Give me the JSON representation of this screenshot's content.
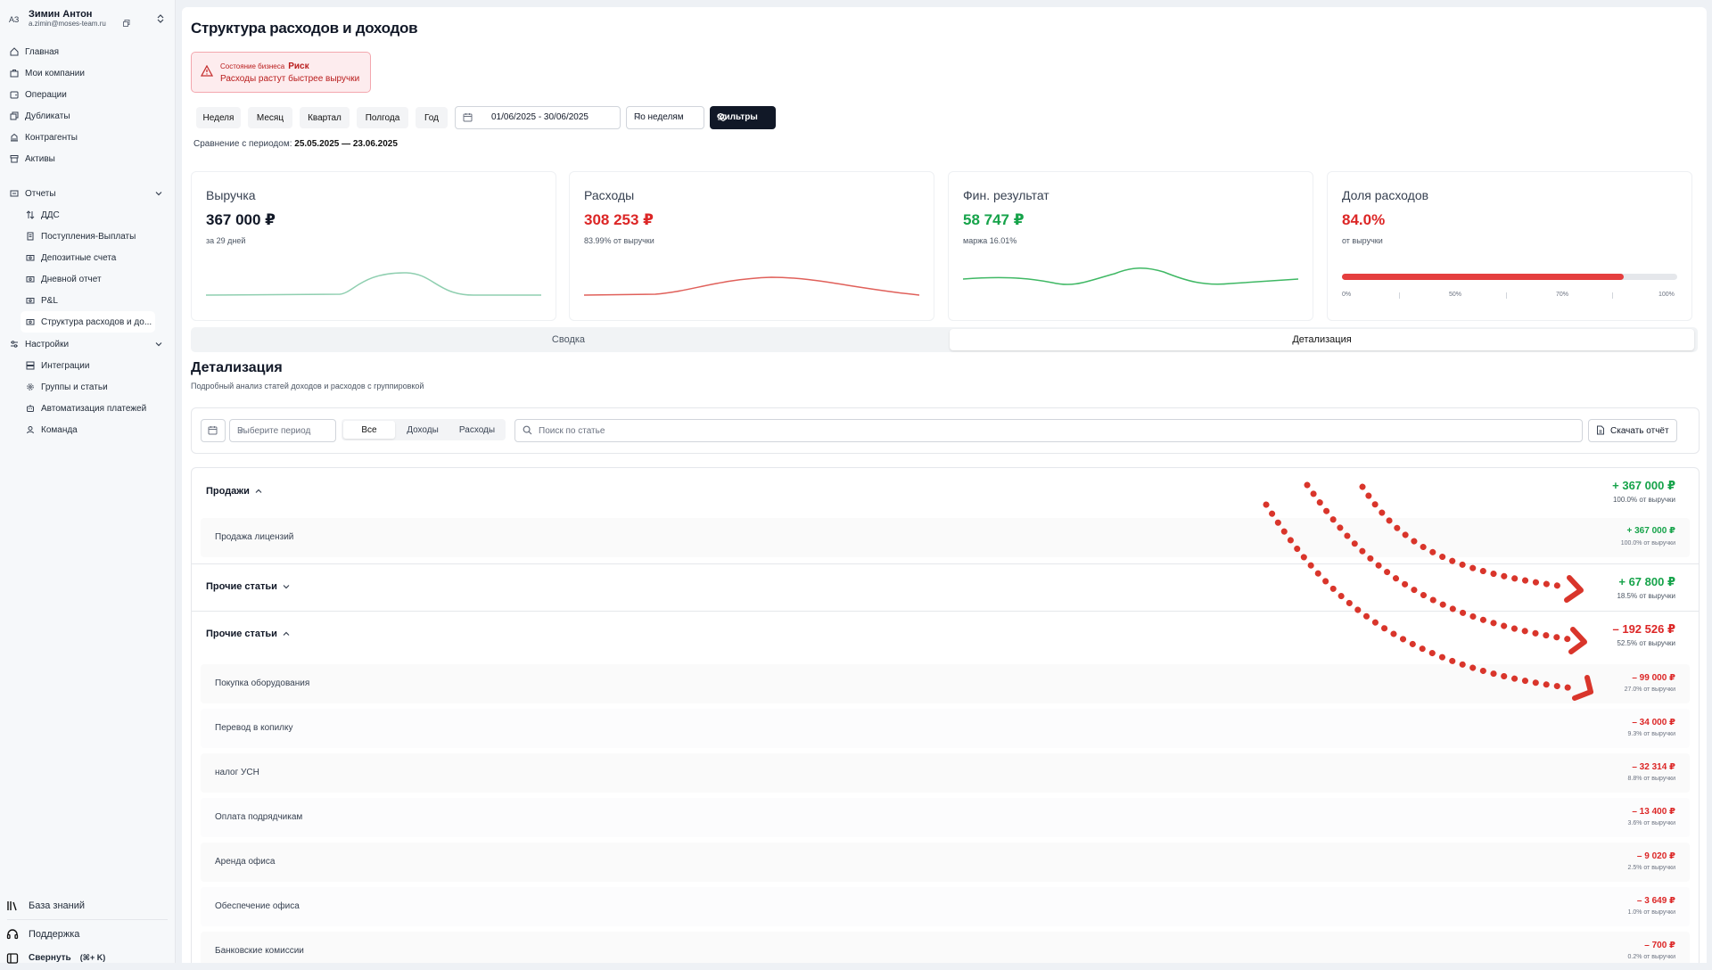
{
  "user": {
    "initials": "АЗ",
    "name": "Зимин Антон",
    "email": "a.zimin@moses-team.ru"
  },
  "nav": {
    "main": [
      {
        "label": "Главная",
        "icon": "home-icon"
      },
      {
        "label": "Мои компании",
        "icon": "briefcase-icon"
      },
      {
        "label": "Операции",
        "icon": "wallet-icon"
      },
      {
        "label": "Дубликаты",
        "icon": "copy-icon"
      },
      {
        "label": "Контрагенты",
        "icon": "building-icon"
      },
      {
        "label": "Активы",
        "icon": "archive-icon"
      }
    ],
    "reports": {
      "label": "Отчеты",
      "items": [
        "ДДС",
        "Поступления-Выплаты",
        "Депозитные счета",
        "Дневной отчет",
        "P&L",
        "Структура расходов и до..."
      ]
    },
    "settings": {
      "label": "Настройки",
      "items": [
        "Интеграции",
        "Группы и статьи",
        "Автоматизация платежей",
        "Команда"
      ]
    },
    "footer": {
      "knowledge": "База знаний",
      "support": "Поддержка",
      "collapse": "Свернуть",
      "collapse_hint": "(⌘+ K)"
    }
  },
  "page": {
    "title": "Структура расходов и доходов",
    "alert": {
      "label": "Состояние бизнеса",
      "status": "Риск",
      "message": "Расходы растут быстрее выручки"
    },
    "periods": [
      "Неделя",
      "Месяц",
      "Квартал",
      "Полгода",
      "Год"
    ],
    "date_range": "01/06/2025 - 30/06/2025",
    "grouping": "По неделям",
    "filters": "Фильтры",
    "comparison_label": "Сравнение с периодом:",
    "comparison_value": "25.05.2025 — 23.06.2025"
  },
  "kpis": [
    {
      "title": "Выручка",
      "value": "367 000 ₽",
      "sub": "за 29 дней",
      "color": "#111827",
      "spark_color": "#8fcfb0"
    },
    {
      "title": "Расходы",
      "value": "308 253 ₽",
      "sub": "83.99% от выручки",
      "color": "#dc2626",
      "spark_color": "#e0605a"
    },
    {
      "title": "Фин. результат",
      "value": "58 747 ₽",
      "sub": "маржа 16.01%",
      "color": "#16a34a",
      "spark_color": "#3fb864"
    },
    {
      "title": "Доля расходов",
      "value": "84.0%",
      "sub": "от выручки",
      "color": "#dc2626",
      "progress": 0.84,
      "ticks": [
        "0%",
        "50%",
        "70%",
        "100%"
      ]
    }
  ],
  "tabs": [
    "Сводка",
    "Детализация"
  ],
  "detail": {
    "title": "Детализация",
    "subtitle": "Подробный анализ статей доходов и расходов с группировкой",
    "period_placeholder": "Выберите период",
    "segments": [
      "Все",
      "Доходы",
      "Расходы"
    ],
    "search_placeholder": "Поиск по статье",
    "download": "Скачать отчёт"
  },
  "rows": [
    {
      "label": "Продажи",
      "amount": "+ 367 000 ₽",
      "pct": "100.0% от выручки",
      "expanded": true,
      "children": [
        {
          "label": "Продажа лицензий",
          "amount": "+ 367 000 ₽",
          "pct": "100.0% от выручки"
        }
      ]
    },
    {
      "label": "Прочие статьи",
      "amount": "+ 67 800 ₽",
      "pct": "18.5% от выручки",
      "expanded": false
    },
    {
      "label": "Прочие статьи",
      "amount": "– 192 526 ₽",
      "pct": "52.5% от выручки",
      "expanded": true,
      "children": [
        {
          "label": "Покупка оборудования",
          "amount": "– 99 000 ₽",
          "pct": "27.0% от выручки"
        },
        {
          "label": "Перевод в копилку",
          "amount": "– 34 000 ₽",
          "pct": "9.3% от выручки"
        },
        {
          "label": "налог УСН",
          "amount": "– 32 314 ₽",
          "pct": "8.8% от выручки"
        },
        {
          "label": "Оплата подрядчикам",
          "amount": "– 13 400 ₽",
          "pct": "3.6% от выручки"
        },
        {
          "label": "Аренда офиса",
          "amount": "– 9 020 ₽",
          "pct": "2.5% от выручки"
        },
        {
          "label": "Обеспечение офиса",
          "amount": "– 3 649 ₽",
          "pct": "1.0% от выручки"
        },
        {
          "label": "Банковские комиссии",
          "amount": "– 700 ₽",
          "pct": "0.2% от выручки"
        }
      ]
    }
  ],
  "colors": {
    "positive": "#16a34a",
    "negative": "#dc2626",
    "annotation": "#d9352b"
  }
}
